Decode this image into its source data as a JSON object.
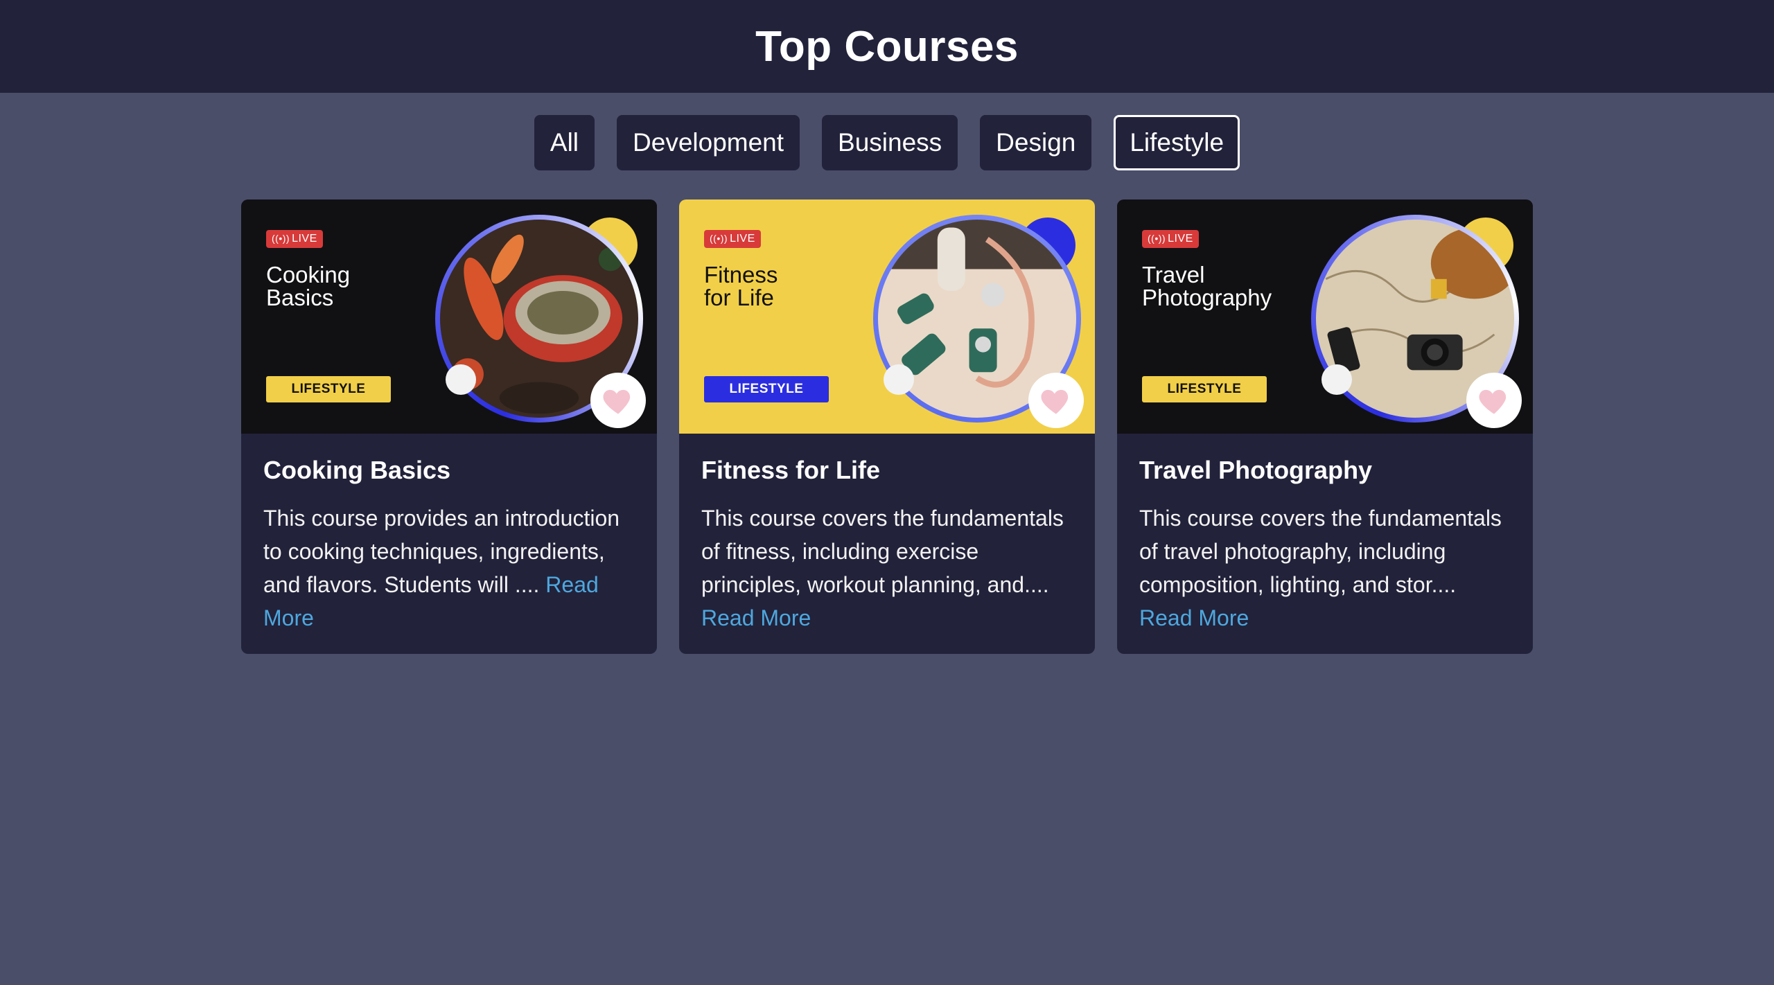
{
  "header": {
    "title": "Top Courses"
  },
  "filters": [
    {
      "label": "All",
      "active": false
    },
    {
      "label": "Development",
      "active": false
    },
    {
      "label": "Business",
      "active": false
    },
    {
      "label": "Design",
      "active": false
    },
    {
      "label": "Lifestyle",
      "active": true
    }
  ],
  "courses": [
    {
      "thumb_live": "LIVE",
      "thumb_title": "Cooking Basics",
      "thumb_tag": "LIFESTYLE",
      "title": "Cooking Basics",
      "description": "This course provides an introduction to cooking techniques, ingredients, and flavors. Students will ....",
      "read_more": "Read More",
      "theme": "dark"
    },
    {
      "thumb_live": "LIVE",
      "thumb_title": "Fitness for Life",
      "thumb_tag": "LIFESTYLE",
      "title": "Fitness for Life",
      "description": "This course covers the fundamentals of fitness, including exercise principles, workout planning, and....",
      "read_more": "Read More",
      "theme": "yellow"
    },
    {
      "thumb_live": "LIVE",
      "thumb_title": "Travel Photography",
      "thumb_tag": "LIFESTYLE",
      "title": "Travel Photography",
      "description": "This course covers the fundamentals of travel photography, including composition, lighting, and stor....",
      "read_more": "Read More",
      "theme": "dark"
    }
  ],
  "colors": {
    "page_bg": "#4a4e69",
    "header_bg": "#22223b",
    "card_bg": "#22223b",
    "accent_yellow": "#f2cf48",
    "accent_blue": "#2b2ee0",
    "link": "#4ea8de",
    "live_red": "#d83a3a",
    "heart_pink": "#f4c2ce"
  },
  "icons": [
    "live-broadcast-icon",
    "heart-icon"
  ]
}
